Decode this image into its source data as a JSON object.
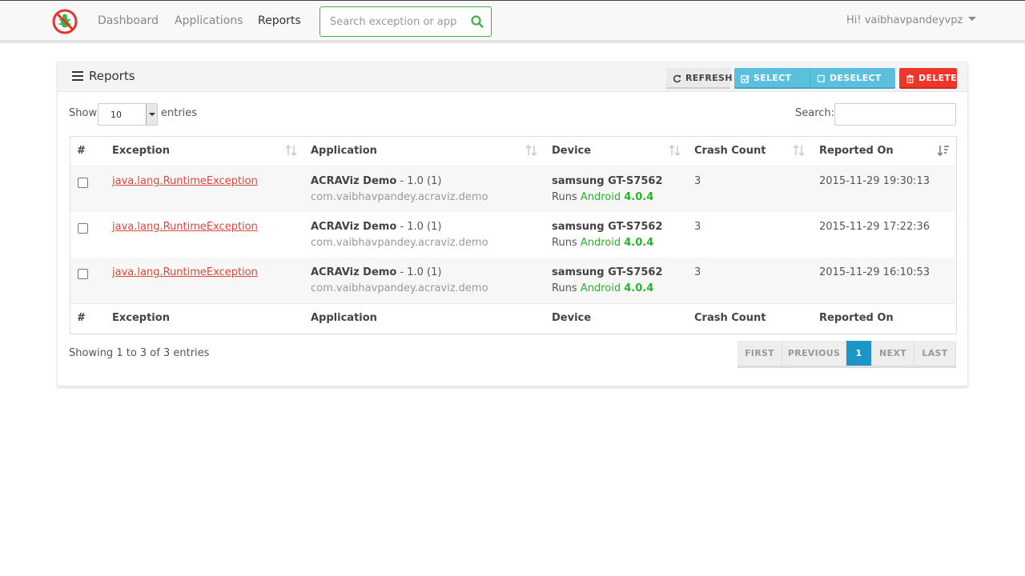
{
  "nav": {
    "links": [
      "Dashboard",
      "Applications",
      "Reports"
    ],
    "active": "Reports",
    "search_placeholder": "Search exception or application",
    "user": "Hi! vaibhavpandeyvpz"
  },
  "panel": {
    "title": "Reports",
    "buttons": {
      "refresh": "REFRESH",
      "select_all": "SELECT ALL",
      "deselect_all": "DESELECT ALL",
      "delete": "DELETE"
    }
  },
  "controls": {
    "show_label": "Show",
    "entries_value": "10",
    "entries_label": "entries",
    "search_label": "Search:"
  },
  "table": {
    "columns": [
      "#",
      "Exception",
      "Application",
      "Device",
      "Crash Count",
      "Reported On"
    ],
    "rows": [
      {
        "exception": "java.lang.RuntimeException",
        "app_name": "ACRAViz Demo",
        "app_version": " - 1.0 (1)",
        "package": "com.vaibhavpandey.acraviz.demo",
        "device": "samsung GT-S7562",
        "runs": "Runs ",
        "os": "Android ",
        "os_version": "4.0.4",
        "crash_count": "3",
        "reported_on": "2015-11-29 19:30:13"
      },
      {
        "exception": "java.lang.RuntimeException",
        "app_name": "ACRAViz Demo",
        "app_version": " - 1.0 (1)",
        "package": "com.vaibhavpandey.acraviz.demo",
        "device": "samsung GT-S7562",
        "runs": "Runs ",
        "os": "Android ",
        "os_version": "4.0.4",
        "crash_count": "3",
        "reported_on": "2015-11-29 17:22:36"
      },
      {
        "exception": "java.lang.RuntimeException",
        "app_name": "ACRAViz Demo",
        "app_version": " - 1.0 (1)",
        "package": "com.vaibhavpandey.acraviz.demo",
        "device": "samsung GT-S7562",
        "runs": "Runs ",
        "os": "Android ",
        "os_version": "4.0.4",
        "crash_count": "3",
        "reported_on": "2015-11-29 16:10:53"
      }
    ]
  },
  "footer": {
    "info": "Showing 1 to 3 of 3 entries",
    "pager": [
      "FIRST",
      "PREVIOUS",
      "1",
      "NEXT",
      "LAST"
    ],
    "active_page": "1"
  },
  "colors": {
    "accent_green": "#3bb34a",
    "info_blue": "#5bc0de",
    "danger_red": "#f0352b",
    "link_red": "#e0463a",
    "pager_active": "#1a96c9"
  }
}
